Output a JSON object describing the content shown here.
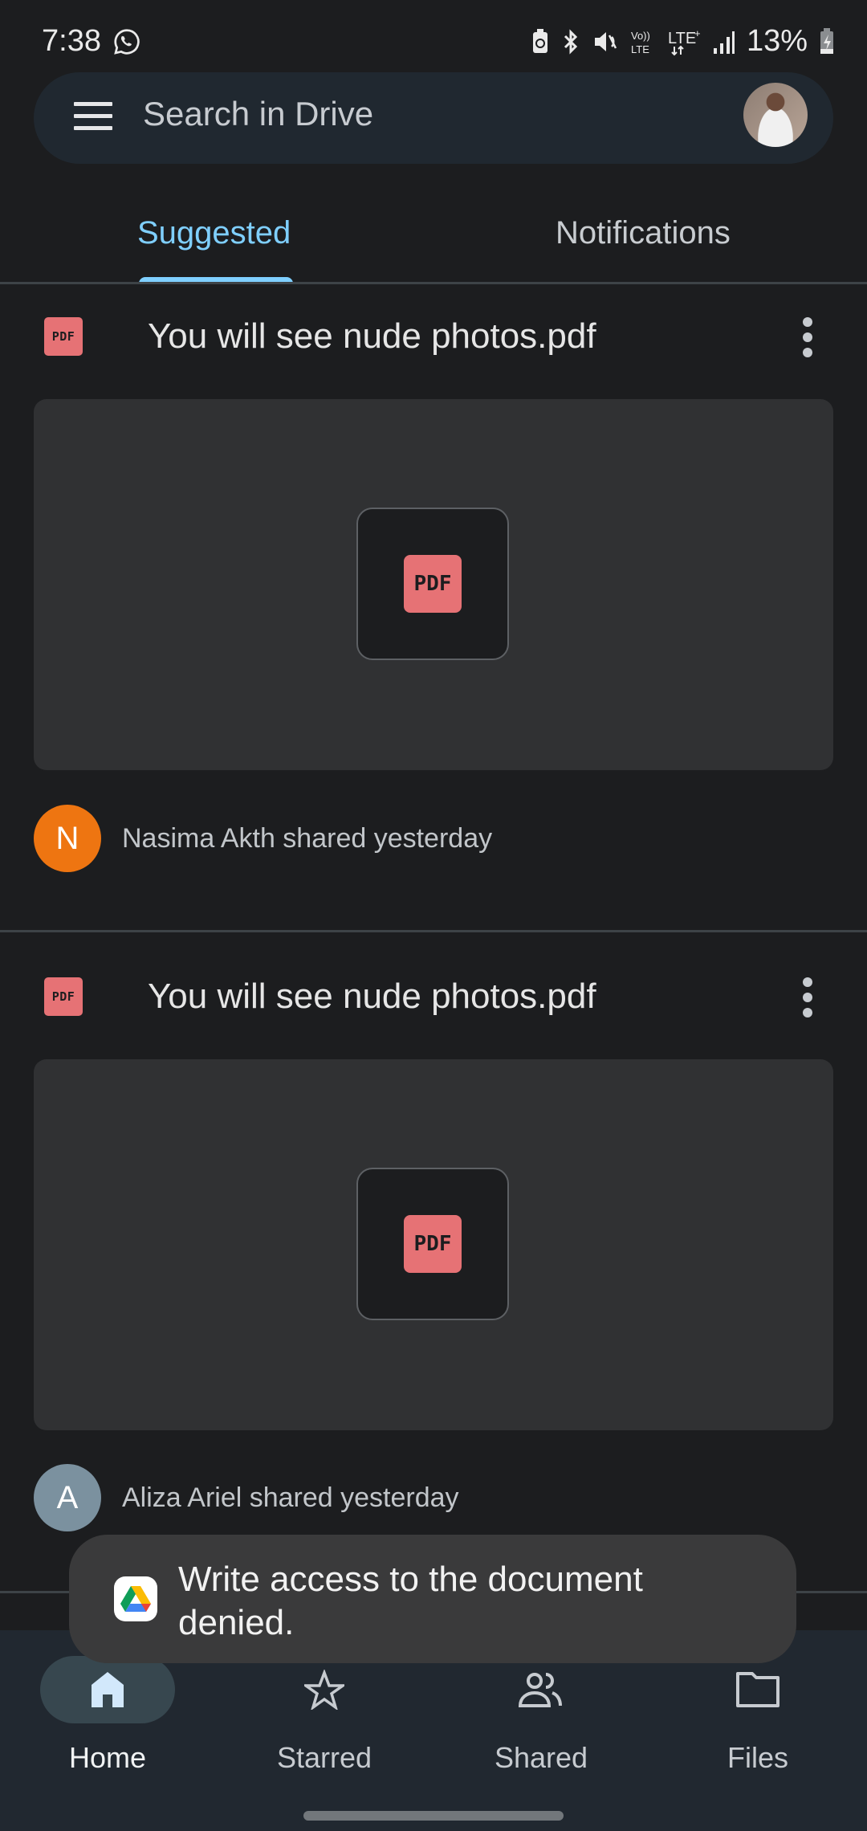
{
  "status_bar": {
    "time": "7:38",
    "notification_icons": [
      "whatsapp-icon"
    ],
    "system_icons": [
      "battery-saver-icon",
      "bluetooth-icon",
      "mute-icon",
      "volte-icon",
      "lte-plus-icon",
      "signal-icon"
    ],
    "battery_percent": "13%"
  },
  "search": {
    "placeholder": "Search in Drive",
    "menu_icon": "menu-icon",
    "account_avatar": "account-avatar"
  },
  "tabs": [
    {
      "label": "Suggested",
      "active": true
    },
    {
      "label": "Notifications",
      "active": false
    }
  ],
  "files": [
    {
      "type_label": "PDF",
      "title": "You will see nude photos.pdf",
      "sharer_initial": "N",
      "sharer_color": "#ee7511",
      "shared_text": "Nasima Akth shared yesterday"
    },
    {
      "type_label": "PDF",
      "title": "You will see nude photos.pdf",
      "sharer_initial": "A",
      "sharer_color": "#7b919f",
      "shared_text": "Aliza Ariel shared yesterday"
    }
  ],
  "snackbar": {
    "message": "Write access to the document denied."
  },
  "bottom_nav": [
    {
      "label": "Home",
      "icon": "home-icon",
      "active": true
    },
    {
      "label": "Starred",
      "icon": "star-icon",
      "active": false
    },
    {
      "label": "Shared",
      "icon": "shared-people-icon",
      "active": false
    },
    {
      "label": "Files",
      "icon": "folder-icon",
      "active": false
    }
  ],
  "colors": {
    "accent": "#7fcfff",
    "pdf_red": "#e67275",
    "background": "#1c1d1f"
  }
}
